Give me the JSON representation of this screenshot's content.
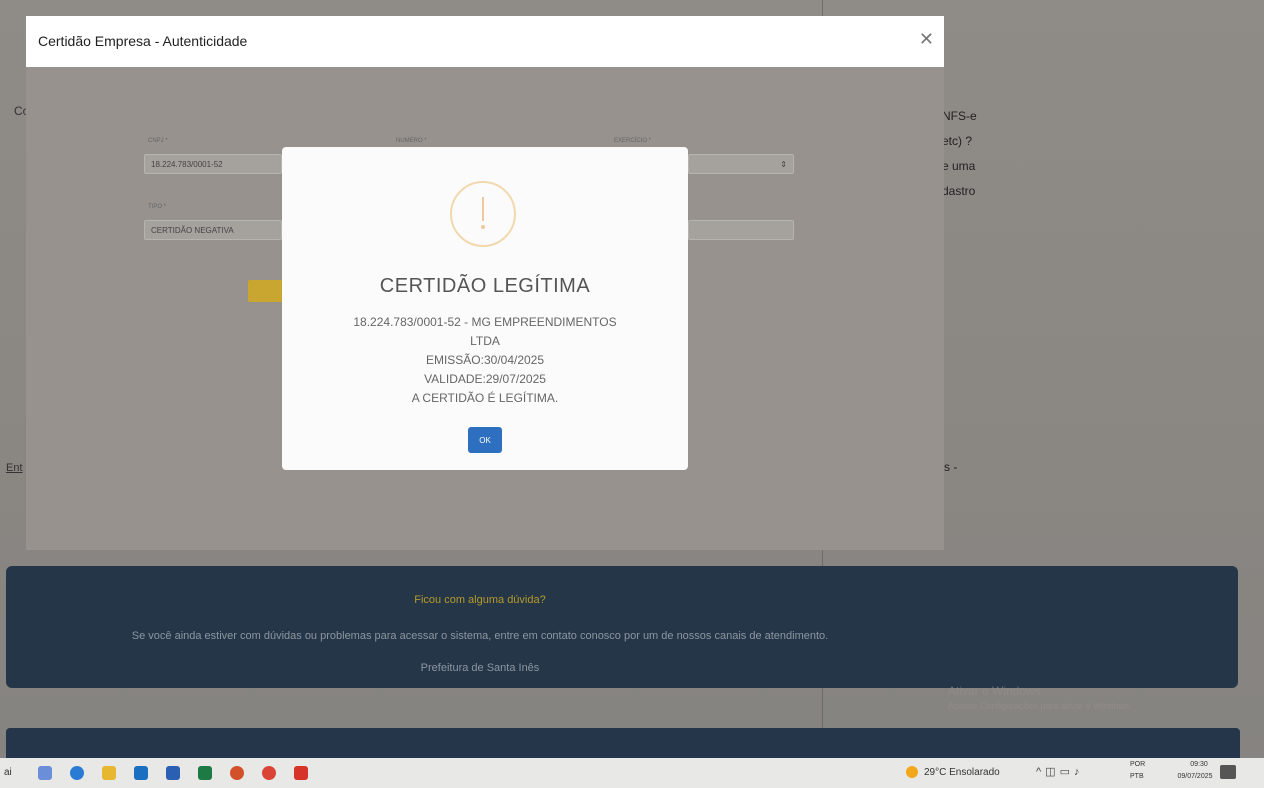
{
  "background": {
    "left_fragment_top": "Co",
    "left_fragment_bottom": "Ent",
    "right_fragments": [
      "NFS-e",
      "etc) ?",
      "e uma",
      "dastro"
    ],
    "right_dash": "s -",
    "footer": {
      "title": "Ficou com alguma dúvida?",
      "text": "Se você ainda estiver com dúvidas ou problemas para acessar o sistema, entre em contato conosco por um de nossos canais de atendimento.",
      "city": "Prefeitura de Santa Inês"
    },
    "windows_watermark": "Ativar o Windows",
    "windows_watermark_sub": "Acesse Configurações para ativar o Windows."
  },
  "outer_modal": {
    "title": "Certidão Empresa - Autenticidade",
    "form": {
      "cnpj_label": "CNPJ *",
      "cnpj_value": "18.224.783/0001-52",
      "numero_label": "NUMERO *",
      "exercicio_label": "EXERCÍCIO *",
      "tipo_label": "TIPO *",
      "tipo_value": "CERTIDÃO NEGATIVA"
    }
  },
  "dialog": {
    "icon": "exclamation-icon",
    "title": "CERTIDÃO LEGÍTIMA",
    "lines": [
      "18.224.783/0001-52 - MG EMPREENDIMENTOS",
      "LTDA",
      "EMISSÃO:30/04/2025",
      "VALIDADE:29/07/2025",
      "A CERTIDÃO É LEGÍTIMA."
    ],
    "ok_label": "OK",
    "accent_color": "#2e6fbf",
    "warning_color": "#f1c79b"
  },
  "taskbar": {
    "left_text": "ai",
    "apps": [
      "copilot-icon",
      "edge-icon",
      "file-explorer-icon",
      "outlook-icon",
      "word-icon",
      "excel-icon",
      "powerpoint-icon",
      "chrome-icon",
      "acrobat-icon"
    ],
    "weather": "29°C  Ensolarado",
    "lang_line1": "POR",
    "lang_line2": "PTB",
    "time": "09:30",
    "date": "09/07/2025"
  }
}
